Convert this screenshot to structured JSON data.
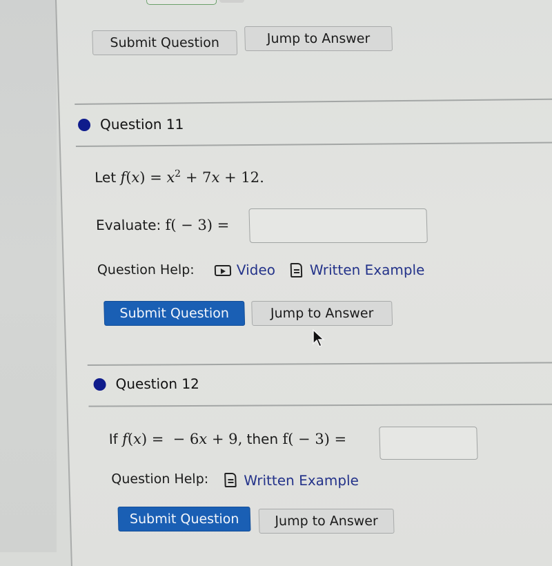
{
  "previous_question": {
    "submit_label": "Submit Question",
    "jump_label": "Jump to Answer"
  },
  "questions": [
    {
      "title": "Question 11",
      "statement_prefix": "Let",
      "statement_math": "f(x) = x² + 7x + 12.",
      "prompt_label": "Evaluate:",
      "prompt_math": "f( − 3) =",
      "answer_value": "",
      "help_label": "Question Help:",
      "help_links": [
        {
          "label": "Video",
          "icon": "video-icon"
        },
        {
          "label": "Written Example",
          "icon": "document-icon"
        }
      ],
      "submit_label": "Submit Question",
      "jump_label": "Jump to Answer",
      "status_color": "#0f1c8c"
    },
    {
      "title": "Question 12",
      "statement_prefix": "If",
      "statement_math": "f(x) =  − 6x + 9,",
      "statement_mid": "then",
      "prompt_math": "f( − 3) =",
      "answer_value": "",
      "help_label": "Question Help:",
      "help_links": [
        {
          "label": "Written Example",
          "icon": "document-icon"
        }
      ],
      "submit_label": "Submit Question",
      "jump_label": "Jump to Answer",
      "status_color": "#0f1c8c"
    }
  ],
  "colors": {
    "primary_button": "#1a5fb4",
    "link": "#24338a",
    "status_dot": "#0f1c8c"
  }
}
